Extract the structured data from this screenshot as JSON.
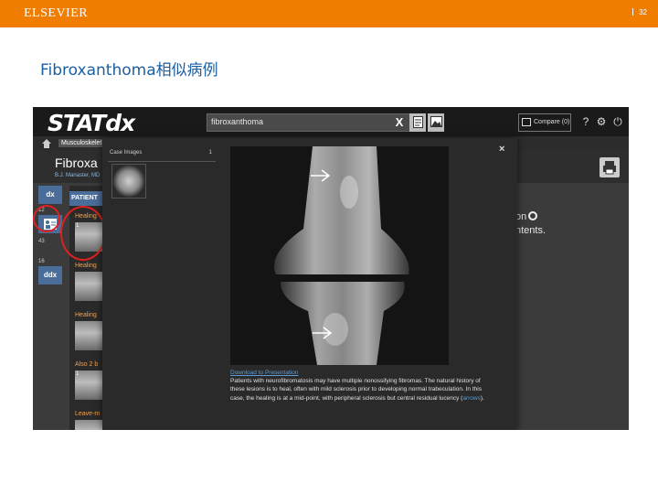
{
  "banner": {
    "brand": "ELSEVIER",
    "page_number": "32"
  },
  "slide": {
    "title": "Fibroxanthoma相似病例"
  },
  "app": {
    "logo": "STATdx",
    "search": {
      "value": "fibroxanthoma"
    },
    "compare_label": "Compare (0)",
    "breadcrumb": "Musculoskelet",
    "topic": {
      "title": "Fibroxa",
      "author": "B.J. Manaster, MD"
    },
    "rail": {
      "btn1": "dx",
      "count1": "12",
      "count2": "43",
      "count3": "16",
      "btn4": "ddx"
    },
    "patient_tab": "PATIENT",
    "cases": [
      {
        "label": "Healing",
        "num": "1"
      },
      {
        "label": "Healing",
        "num": ""
      },
      {
        "label": "Healing",
        "num": ""
      },
      {
        "label": "Also 2 b",
        "num": "1"
      },
      {
        "label": "Leave-m",
        "num": ""
      }
    ],
    "right_text": {
      "line1": "on",
      "line2": "ntents."
    }
  },
  "modal": {
    "side_title": "Case Images",
    "side_count": "1",
    "close": "×",
    "download_link": "Download to Presentation",
    "caption_text": "Patients with neurofibromatosis may have multiple nonossifying fibromas. The natural history of these lesions is to heal, often with mild sclerosis prior to developing normal trabeculation. In this case, the healing is at a mid-point, with peripheral sclerosis but central residual lucency (",
    "caption_link": "arrows",
    "caption_end": ")."
  },
  "colors": {
    "banner": "#f07d00",
    "title": "#1c5fa0",
    "accent_blue": "#4b6d9a",
    "highlight_red": "#e02020"
  }
}
